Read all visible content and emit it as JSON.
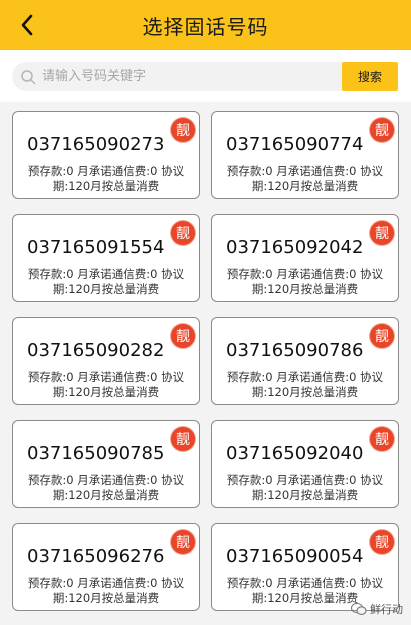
{
  "header": {
    "title": "选择固话号码"
  },
  "search": {
    "placeholder": "请输入号码关键字",
    "button_label": "搜索"
  },
  "badge_text": "靓",
  "numbers": [
    {
      "number": "037165090273",
      "desc": "预存款:0 月承诺通信费:0 协议期:120月按总量消费"
    },
    {
      "number": "037165090774",
      "desc": "预存款:0 月承诺通信费:0 协议期:120月按总量消费"
    },
    {
      "number": "037165091554",
      "desc": "预存款:0 月承诺通信费:0 协议期:120月按总量消费"
    },
    {
      "number": "037165092042",
      "desc": "预存款:0 月承诺通信费:0 协议期:120月按总量消费"
    },
    {
      "number": "037165090282",
      "desc": "预存款:0 月承诺通信费:0 协议期:120月按总量消费"
    },
    {
      "number": "037165090786",
      "desc": "预存款:0 月承诺通信费:0 协议期:120月按总量消费"
    },
    {
      "number": "037165090785",
      "desc": "预存款:0 月承诺通信费:0 协议期:120月按总量消费"
    },
    {
      "number": "037165092040",
      "desc": "预存款:0 月承诺通信费:0 协议期:120月按总量消费"
    },
    {
      "number": "037165096276",
      "desc": "预存款:0 月承诺通信费:0 协议期:120月按总量消费"
    },
    {
      "number": "037165090054",
      "desc": "预存款:0 月承诺通信费:0 协议期:120月按总量消费"
    }
  ],
  "watermark": {
    "text": "鲜行动"
  },
  "colors": {
    "accent": "#fbc219",
    "badge": "#e8462a"
  }
}
